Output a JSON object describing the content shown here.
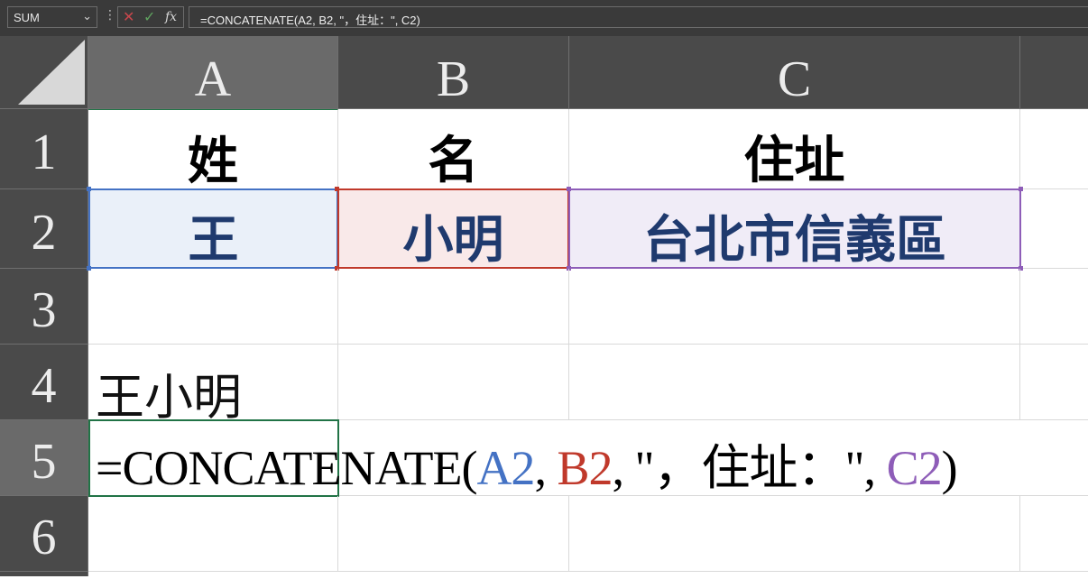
{
  "formula_bar": {
    "name_box": "SUM",
    "fx_label": "fx",
    "formula_text": "=CONCATENATE(A2, B2, \"，住址：\", C2)"
  },
  "columns": [
    "A",
    "B",
    "C"
  ],
  "rows": [
    "1",
    "2",
    "3",
    "4",
    "5",
    "6"
  ],
  "cells": {
    "A1": "姓",
    "B1": "名",
    "C1": "住址",
    "A2": "王",
    "B2": "小明",
    "C2": "台北市信義區",
    "A4": "王小明"
  },
  "formula_parts": [
    "=CONCATENATE(",
    "A2",
    ", ",
    "B2",
    ", \"，住址：\", ",
    "C2",
    ")"
  ],
  "colors": {
    "ref_a2": "#4472c4",
    "ref_b2": "#c0392b",
    "ref_c2": "#8e5db8"
  }
}
